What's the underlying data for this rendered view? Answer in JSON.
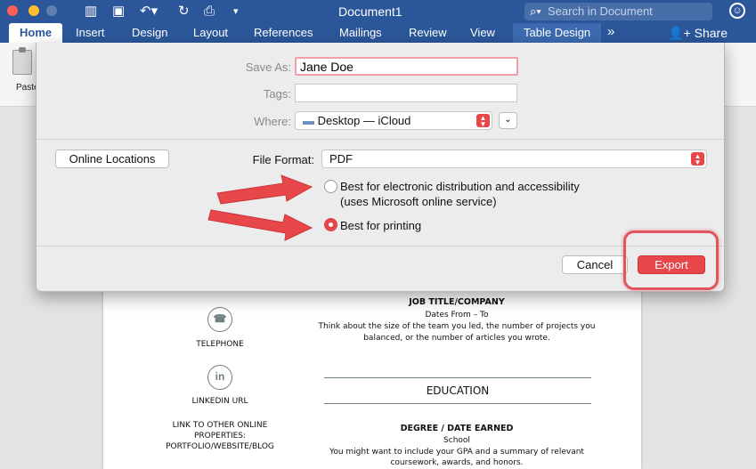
{
  "titlebar": {
    "document_title": "Document1",
    "search_placeholder": "Search in Document"
  },
  "tabs": [
    {
      "label": "Home"
    },
    {
      "label": "Insert"
    },
    {
      "label": "Design"
    },
    {
      "label": "Layout"
    },
    {
      "label": "References"
    },
    {
      "label": "Mailings"
    },
    {
      "label": "Review"
    },
    {
      "label": "View"
    },
    {
      "label": "Table Design"
    },
    {
      "label": "»"
    }
  ],
  "share_label": "Share",
  "ribbon": {
    "paste_label": "Paste"
  },
  "dialog": {
    "save_as_label": "Save As:",
    "save_as_value": "Jane Doe",
    "tags_label": "Tags:",
    "tags_value": "",
    "where_label": "Where:",
    "where_value": "Desktop — iCloud",
    "online_locations_label": "Online Locations",
    "file_format_label": "File Format:",
    "file_format_value": "PDF",
    "option_electronic_line1": "Best for electronic distribution and accessibility",
    "option_electronic_line2": "(uses Microsoft online service)",
    "option_printing": "Best for printing",
    "selected_option": "printing",
    "cancel_label": "Cancel",
    "export_label": "Export"
  },
  "document": {
    "job_title": "JOB TITLE/COMPANY",
    "dates": "Dates From – To",
    "job_desc_line1": "Think about the size of the team you led, the number of projects you",
    "job_desc_line2": "balanced, or the number of articles you wrote.",
    "telephone": "TELEPHONE",
    "linkedin": "LINKEDIN URL",
    "link_other_line1": "LINK TO OTHER ONLINE",
    "link_other_line2": "PROPERTIES:",
    "link_other_line3": "PORTFOLIO/WEBSITE/BLOG",
    "education_heading": "EDUCATION",
    "degree": "DEGREE / DATE EARNED",
    "school": "School",
    "edu_desc_line1": "You might want to include your GPA and a summary of relevant",
    "edu_desc_line2": "coursework, awards, and honors."
  },
  "colors": {
    "word_blue": "#2b579a",
    "annotation_red": "#e8474a",
    "export_red": "#e8474a"
  }
}
